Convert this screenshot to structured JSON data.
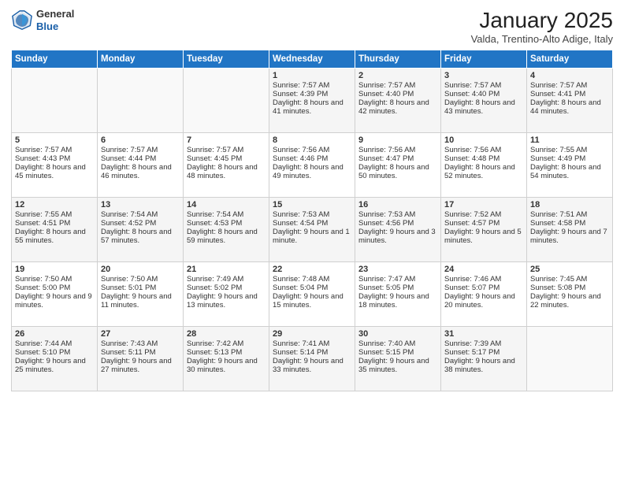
{
  "header": {
    "logo_line1": "General",
    "logo_line2": "Blue",
    "month": "January 2025",
    "location": "Valda, Trentino-Alto Adige, Italy"
  },
  "days_of_week": [
    "Sunday",
    "Monday",
    "Tuesday",
    "Wednesday",
    "Thursday",
    "Friday",
    "Saturday"
  ],
  "weeks": [
    [
      {
        "day": "",
        "text": ""
      },
      {
        "day": "",
        "text": ""
      },
      {
        "day": "",
        "text": ""
      },
      {
        "day": "1",
        "text": "Sunrise: 7:57 AM\nSunset: 4:39 PM\nDaylight: 8 hours and 41 minutes."
      },
      {
        "day": "2",
        "text": "Sunrise: 7:57 AM\nSunset: 4:40 PM\nDaylight: 8 hours and 42 minutes."
      },
      {
        "day": "3",
        "text": "Sunrise: 7:57 AM\nSunset: 4:40 PM\nDaylight: 8 hours and 43 minutes."
      },
      {
        "day": "4",
        "text": "Sunrise: 7:57 AM\nSunset: 4:41 PM\nDaylight: 8 hours and 44 minutes."
      }
    ],
    [
      {
        "day": "5",
        "text": "Sunrise: 7:57 AM\nSunset: 4:43 PM\nDaylight: 8 hours and 45 minutes."
      },
      {
        "day": "6",
        "text": "Sunrise: 7:57 AM\nSunset: 4:44 PM\nDaylight: 8 hours and 46 minutes."
      },
      {
        "day": "7",
        "text": "Sunrise: 7:57 AM\nSunset: 4:45 PM\nDaylight: 8 hours and 48 minutes."
      },
      {
        "day": "8",
        "text": "Sunrise: 7:56 AM\nSunset: 4:46 PM\nDaylight: 8 hours and 49 minutes."
      },
      {
        "day": "9",
        "text": "Sunrise: 7:56 AM\nSunset: 4:47 PM\nDaylight: 8 hours and 50 minutes."
      },
      {
        "day": "10",
        "text": "Sunrise: 7:56 AM\nSunset: 4:48 PM\nDaylight: 8 hours and 52 minutes."
      },
      {
        "day": "11",
        "text": "Sunrise: 7:55 AM\nSunset: 4:49 PM\nDaylight: 8 hours and 54 minutes."
      }
    ],
    [
      {
        "day": "12",
        "text": "Sunrise: 7:55 AM\nSunset: 4:51 PM\nDaylight: 8 hours and 55 minutes."
      },
      {
        "day": "13",
        "text": "Sunrise: 7:54 AM\nSunset: 4:52 PM\nDaylight: 8 hours and 57 minutes."
      },
      {
        "day": "14",
        "text": "Sunrise: 7:54 AM\nSunset: 4:53 PM\nDaylight: 8 hours and 59 minutes."
      },
      {
        "day": "15",
        "text": "Sunrise: 7:53 AM\nSunset: 4:54 PM\nDaylight: 9 hours and 1 minute."
      },
      {
        "day": "16",
        "text": "Sunrise: 7:53 AM\nSunset: 4:56 PM\nDaylight: 9 hours and 3 minutes."
      },
      {
        "day": "17",
        "text": "Sunrise: 7:52 AM\nSunset: 4:57 PM\nDaylight: 9 hours and 5 minutes."
      },
      {
        "day": "18",
        "text": "Sunrise: 7:51 AM\nSunset: 4:58 PM\nDaylight: 9 hours and 7 minutes."
      }
    ],
    [
      {
        "day": "19",
        "text": "Sunrise: 7:50 AM\nSunset: 5:00 PM\nDaylight: 9 hours and 9 minutes."
      },
      {
        "day": "20",
        "text": "Sunrise: 7:50 AM\nSunset: 5:01 PM\nDaylight: 9 hours and 11 minutes."
      },
      {
        "day": "21",
        "text": "Sunrise: 7:49 AM\nSunset: 5:02 PM\nDaylight: 9 hours and 13 minutes."
      },
      {
        "day": "22",
        "text": "Sunrise: 7:48 AM\nSunset: 5:04 PM\nDaylight: 9 hours and 15 minutes."
      },
      {
        "day": "23",
        "text": "Sunrise: 7:47 AM\nSunset: 5:05 PM\nDaylight: 9 hours and 18 minutes."
      },
      {
        "day": "24",
        "text": "Sunrise: 7:46 AM\nSunset: 5:07 PM\nDaylight: 9 hours and 20 minutes."
      },
      {
        "day": "25",
        "text": "Sunrise: 7:45 AM\nSunset: 5:08 PM\nDaylight: 9 hours and 22 minutes."
      }
    ],
    [
      {
        "day": "26",
        "text": "Sunrise: 7:44 AM\nSunset: 5:10 PM\nDaylight: 9 hours and 25 minutes."
      },
      {
        "day": "27",
        "text": "Sunrise: 7:43 AM\nSunset: 5:11 PM\nDaylight: 9 hours and 27 minutes."
      },
      {
        "day": "28",
        "text": "Sunrise: 7:42 AM\nSunset: 5:13 PM\nDaylight: 9 hours and 30 minutes."
      },
      {
        "day": "29",
        "text": "Sunrise: 7:41 AM\nSunset: 5:14 PM\nDaylight: 9 hours and 33 minutes."
      },
      {
        "day": "30",
        "text": "Sunrise: 7:40 AM\nSunset: 5:15 PM\nDaylight: 9 hours and 35 minutes."
      },
      {
        "day": "31",
        "text": "Sunrise: 7:39 AM\nSunset: 5:17 PM\nDaylight: 9 hours and 38 minutes."
      },
      {
        "day": "",
        "text": ""
      }
    ]
  ]
}
